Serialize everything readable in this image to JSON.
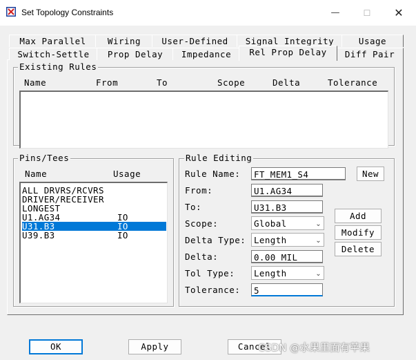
{
  "window": {
    "title": "Set Topology Constraints",
    "icon": "app-icon",
    "controls": {
      "minimize": "—",
      "maximize": "☐",
      "close": "✕"
    }
  },
  "tabs": {
    "row1": [
      "Max Parallel",
      "Wiring",
      "User-Defined",
      "Signal Integrity",
      "Usage"
    ],
    "row2": [
      "Switch-Settle",
      "Prop Delay",
      "Impedance",
      "Rel Prop Delay",
      "Diff Pair"
    ],
    "active": "Rel Prop Delay"
  },
  "existing_rules": {
    "label": "Existing Rules",
    "columns": [
      "Name",
      "From",
      "To",
      "Scope",
      "Delta",
      "Tolerance"
    ],
    "rows": []
  },
  "pins_tees": {
    "label": "Pins/Tees",
    "columns": [
      "Name",
      "Usage"
    ],
    "items": [
      {
        "name": "ALL DRVRS/RCVRS",
        "usage": ""
      },
      {
        "name": "DRIVER/RECEIVER",
        "usage": ""
      },
      {
        "name": "LONGEST",
        "usage": ""
      },
      {
        "name": "U1.AG34",
        "usage": "IO"
      },
      {
        "name": "U31.B3",
        "usage": "IO",
        "selected": true
      },
      {
        "name": "U39.B3",
        "usage": "IO"
      }
    ]
  },
  "rule_editing": {
    "label": "Rule Editing",
    "rule_name_label": "Rule Name:",
    "rule_name_value": "FT_MEM1_S4",
    "from_label": "From:",
    "from_value": "U1.AG34",
    "to_label": "To:",
    "to_value": "U31.B3",
    "scope_label": "Scope:",
    "scope_value": "Global",
    "delta_type_label": "Delta Type:",
    "delta_type_value": "Length",
    "delta_label": "Delta:",
    "delta_value": "0.00 MIL",
    "tol_type_label": "Tol Type:",
    "tol_type_value": "Length",
    "tolerance_label": "Tolerance:",
    "tolerance_value": "5",
    "new_button": "New",
    "add_button": "Add",
    "modify_button": "Modify",
    "delete_button": "Delete"
  },
  "footer": {
    "ok": "OK",
    "apply": "Apply",
    "cancel": "Cancel"
  },
  "watermark": "CSDN @水果里面有苹果",
  "colors": {
    "selection": "#0078d7",
    "background": "#f0f0f0"
  }
}
